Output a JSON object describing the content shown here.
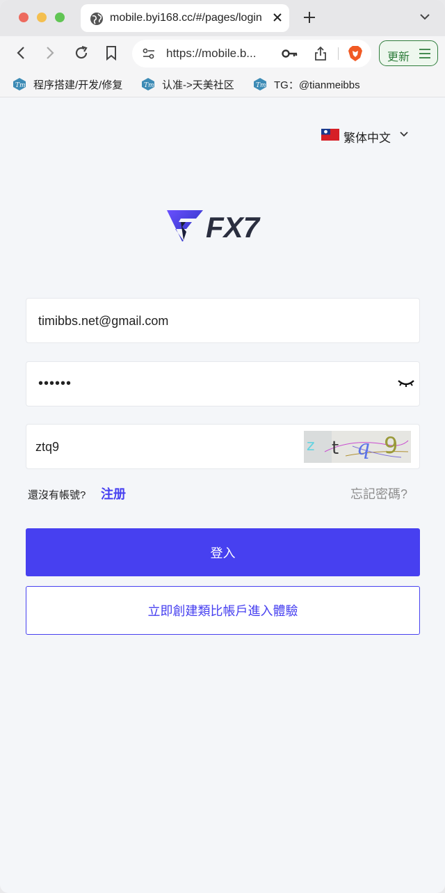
{
  "browser": {
    "tab_title": "mobile.byi168.cc/#/pages/login",
    "url": "https://mobile.b...",
    "update_label": "更新",
    "bookmarks": [
      {
        "label": "程序搭建/开发/修复"
      },
      {
        "label": "认准->天美社区"
      },
      {
        "label": "TG：@tianmeibbs"
      }
    ]
  },
  "page": {
    "language": "繁体中文",
    "logo_text": "FX7",
    "email_value": "timibbs.net@gmail.com",
    "password_value": "••••••",
    "captcha_value": "ztq9",
    "captcha_image_text": "z t q 9",
    "no_account_text": "還沒有帳號?",
    "register_label": "注册",
    "forgot_label": "忘記密碼?",
    "login_label": "登入",
    "demo_label": "立即創建類比帳戶進入體驗"
  },
  "colors": {
    "primary": "#4740f0",
    "update_green": "#2f7d3c",
    "background": "#f4f6f9"
  }
}
